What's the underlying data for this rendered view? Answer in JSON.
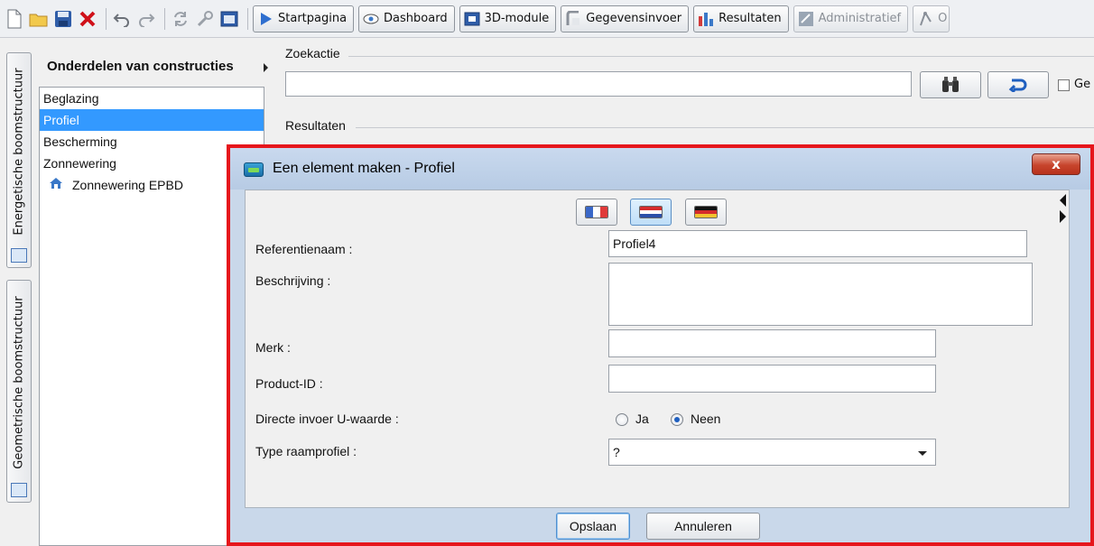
{
  "toolbar": {
    "buttons": [
      {
        "label": "Startpagina",
        "icon": "play-icon"
      },
      {
        "label": "Dashboard",
        "icon": "eye-icon"
      },
      {
        "label": "3D-module",
        "icon": "cube-icon"
      },
      {
        "label": "Gegevensinvoer",
        "icon": "input-icon"
      },
      {
        "label": "Resultaten",
        "icon": "chart-icon"
      },
      {
        "label": "Administratief",
        "icon": "admin-icon"
      },
      {
        "label": "O",
        "icon": "compass-icon"
      }
    ]
  },
  "sidetabs": {
    "energetic": "Energetische boomstructuur",
    "geometric": "Geometrische boomstructuur"
  },
  "tree": {
    "header": "Onderdelen van constructies",
    "items": [
      {
        "label": "Beglazing"
      },
      {
        "label": "Profiel"
      },
      {
        "label": "Bescherming"
      },
      {
        "label": "Zonnewering"
      },
      {
        "label": "Zonnewering EPBD"
      }
    ]
  },
  "search": {
    "section_label": "Zoekactie",
    "value": "",
    "checkbox_label": "Ge"
  },
  "results": {
    "section_label": "Resultaten"
  },
  "dialog": {
    "title": "Een element maken - Profiel",
    "close_label": "x",
    "languages": [
      "fr",
      "nl",
      "de"
    ],
    "fields": {
      "reference_label": "Referentienaam :",
      "reference_value": "Profiel4",
      "description_label": "Beschrijving :",
      "description_value": "",
      "brand_label": "Merk :",
      "brand_value": "",
      "product_id_label": "Product-ID :",
      "product_id_value": "",
      "u_value_label": "Directe invoer U-waarde :",
      "u_value_yes": "Ja",
      "u_value_no": "Neen",
      "frame_type_label": "Type raamprofiel :",
      "frame_type_value": "?"
    },
    "save_label": "Opslaan",
    "cancel_label": "Annuleren"
  },
  "colors": {
    "selection": "#3399ff",
    "dialog_border": "#e6161c",
    "close_button": "#c7442c"
  }
}
